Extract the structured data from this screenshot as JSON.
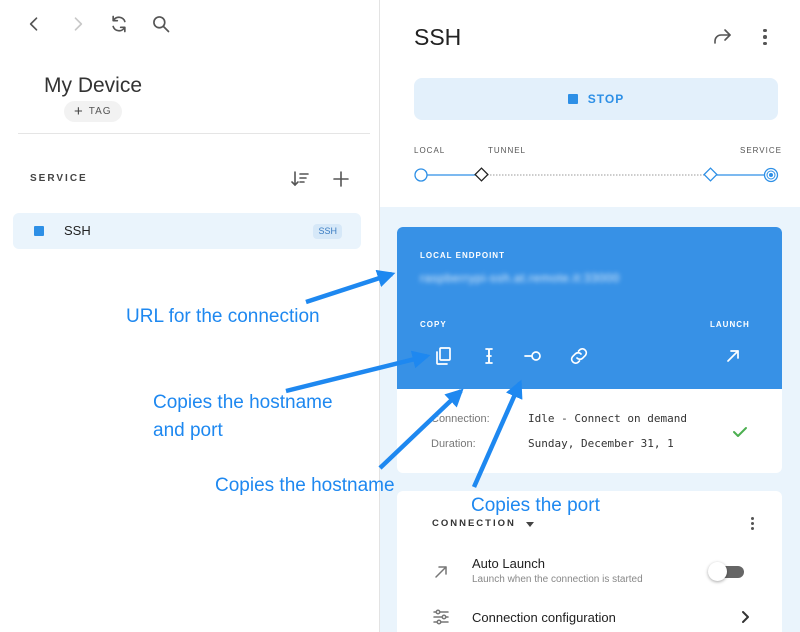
{
  "left": {
    "nav": {
      "back_icon": "chevron-left-icon",
      "forward_icon": "chevron-right-icon",
      "refresh_icon": "refresh-icon",
      "search_icon": "search-icon"
    },
    "device_name": "My Device",
    "tag_label": "TAG",
    "service_heading": "SERVICE",
    "services": [
      {
        "name": "SSH",
        "badge": "SSH"
      }
    ]
  },
  "right": {
    "title": "SSH",
    "stop_label": "STOP",
    "timeline": {
      "local": "LOCAL",
      "tunnel": "TUNNEL",
      "service": "SERVICE"
    },
    "endpoint": {
      "heading": "LOCAL ENDPOINT",
      "url": "raspberrypi-ssh.at.remote.it:33000",
      "copy_heading": "COPY",
      "launch_heading": "LAUNCH"
    },
    "details": {
      "connection_label": "Connection:",
      "connection_value": "Idle - Connect on demand",
      "duration_label": "Duration:",
      "duration_value": "Sunday, December 31, 1"
    },
    "connection_card": {
      "heading": "CONNECTION",
      "auto_launch_title": "Auto Launch",
      "auto_launch_subtitle": "Launch when the connection is started",
      "auto_launch_on": false,
      "config_title": "Connection configuration"
    }
  },
  "colors": {
    "accent": "#2d8fe6",
    "endpoint_bg": "#3791e6",
    "annotation": "#1e88f0",
    "pane_bg": "#eaf4fc"
  },
  "annotations": {
    "url": "URL for the connection",
    "hostname_port": "Copies the hostname and port",
    "hostname": "Copies the hostname",
    "port": "Copies the port"
  }
}
